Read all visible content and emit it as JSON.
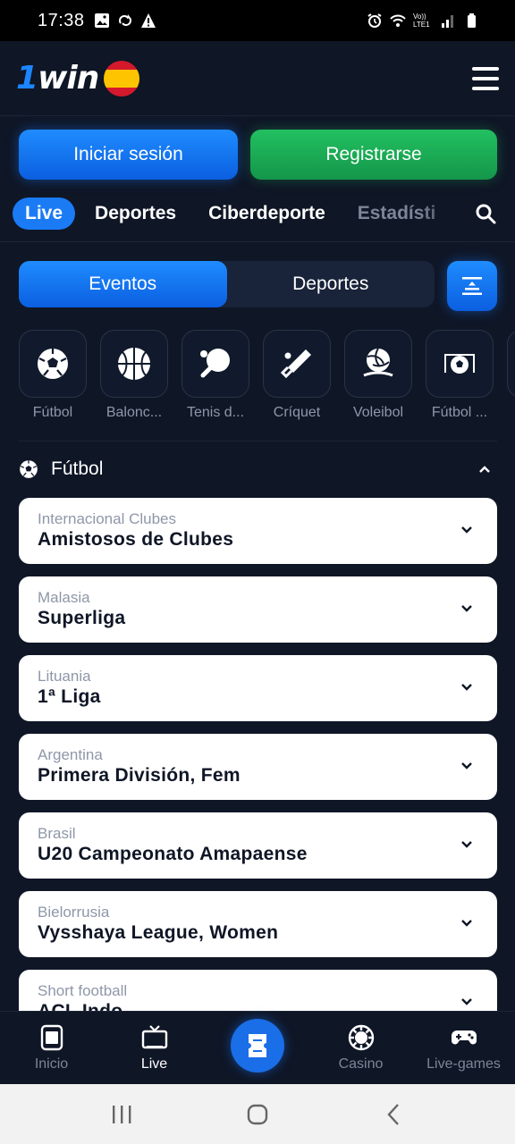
{
  "status_bar": {
    "time": "17:38",
    "left_icons": [
      "image-icon",
      "sync-icon",
      "warning-icon"
    ],
    "right_icons": [
      "alarm-icon",
      "wifi-icon",
      "volte-icon",
      "signal-icon",
      "battery-icon"
    ],
    "volte_label": "Vo)) LTE1"
  },
  "header": {
    "logo_one": "1",
    "logo_win": "win",
    "flag": "spain-flag-icon",
    "menu_icon": "hamburger-menu-icon"
  },
  "auth": {
    "login_label": "Iniciar sesión",
    "register_label": "Registrarse"
  },
  "nav_tabs": [
    {
      "label": "Live",
      "active": true
    },
    {
      "label": "Deportes",
      "active": false
    },
    {
      "label": "Ciberdeporte",
      "active": false
    },
    {
      "label": "Estadísti",
      "active": false
    }
  ],
  "segment": {
    "events_label": "Eventos",
    "sports_label": "Deportes",
    "active": "Eventos"
  },
  "sports": [
    {
      "label": "Fútbol",
      "icon": "soccer-ball-icon"
    },
    {
      "label": "Balonc...",
      "icon": "basketball-icon"
    },
    {
      "label": "Tenis d...",
      "icon": "table-tennis-icon"
    },
    {
      "label": "Críquet",
      "icon": "cricket-icon"
    },
    {
      "label": "Voleibol",
      "icon": "volleyball-icon"
    },
    {
      "label": "Fútbol ...",
      "icon": "futsal-icon"
    }
  ],
  "section": {
    "title": "Fútbol",
    "icon": "soccer-ball-icon",
    "expanded": true
  },
  "leagues": [
    {
      "country": "Internacional Clubes",
      "league": "Amistosos de Clubes"
    },
    {
      "country": "Malasia",
      "league": "Superliga"
    },
    {
      "country": "Lituania",
      "league": "1ª Liga"
    },
    {
      "country": "Argentina",
      "league": "Primera División, Fem"
    },
    {
      "country": "Brasil",
      "league": "U20 Campeonato Amapaense"
    },
    {
      "country": "Bielorrusia",
      "league": "Vysshaya League, Women"
    },
    {
      "country": "Short football",
      "league": "ACL Indo"
    }
  ],
  "bottom_nav": {
    "home": "Inicio",
    "live": "Live",
    "casino": "Casino",
    "live_games": "Live-games",
    "active": "Live"
  },
  "colors": {
    "background": "#0f1626",
    "accent_blue": "#1a7bf5",
    "accent_green": "#1fae58",
    "muted_text": "#8e97a8"
  }
}
